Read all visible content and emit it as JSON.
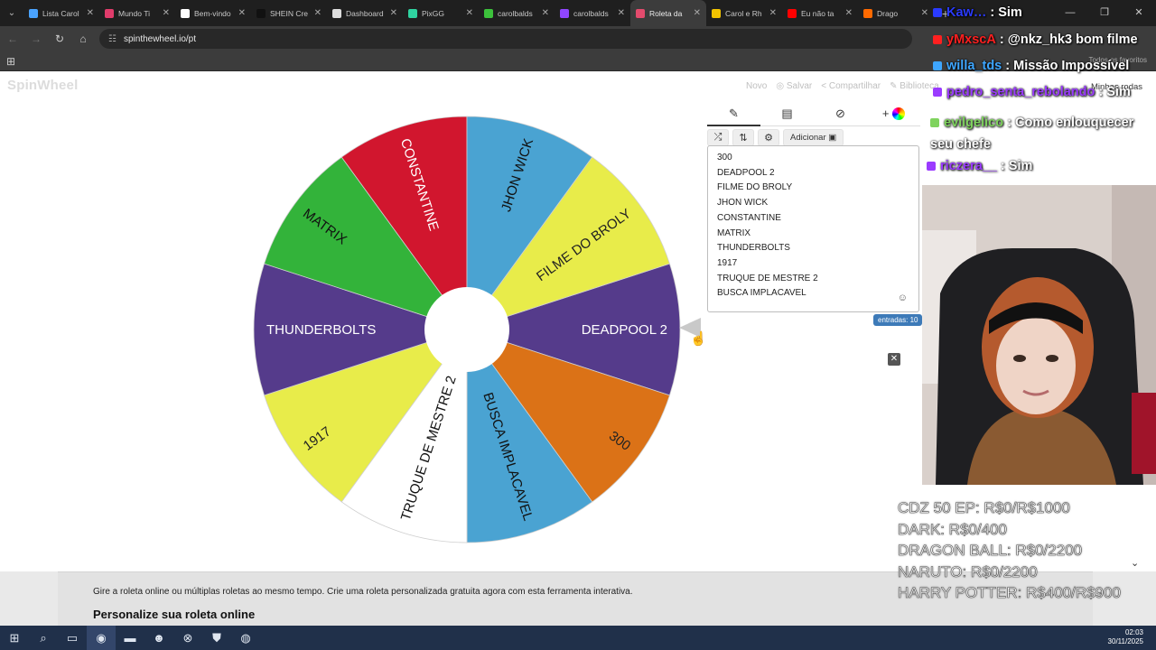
{
  "browser": {
    "tabs": [
      {
        "label": "Lista Carol",
        "color": "#4aa3ff",
        "active": false
      },
      {
        "label": "Mundo Ti",
        "color": "#e03c6b",
        "active": false
      },
      {
        "label": "Bem-vindo",
        "color": "#ffffff",
        "active": false
      },
      {
        "label": "SHEIN Cre",
        "color": "#111111",
        "active": false
      },
      {
        "label": "Dashboard",
        "color": "#dddddd",
        "active": false
      },
      {
        "label": "PixGG",
        "color": "#2fd3a0",
        "active": false
      },
      {
        "label": "carolbalds",
        "color": "#3cc13b",
        "active": false
      },
      {
        "label": "carolbalds",
        "color": "#9146ff",
        "active": false
      },
      {
        "label": "Roleta da",
        "color": "#e34b6d",
        "active": true
      },
      {
        "label": "Carol e Rh",
        "color": "#f2c300",
        "active": false
      },
      {
        "label": "Eu não ta",
        "color": "#ff0000",
        "active": false
      },
      {
        "label": "Drago",
        "color": "#ff6a00",
        "active": false
      }
    ],
    "url": "spinthewheel.io/pt",
    "favorites_label": "Todos os favoritos"
  },
  "site": {
    "logo": "SpinWheel",
    "toolbar": {
      "novo": "Novo",
      "salvar": "Salvar",
      "compartilhar": "Compartilhar",
      "biblioteca": "Biblioteca"
    },
    "my_wheels": "Minhas rodas"
  },
  "wheel": {
    "segments": [
      {
        "label": "DEADPOOL 2",
        "color": "#553b8b",
        "text_color": "#ffffff"
      },
      {
        "label": "300",
        "color": "#db7217",
        "text_color": "#222222"
      },
      {
        "label": "BUSCA IMPLACAVEL",
        "color": "#4aa3d2",
        "text_color": "#111111"
      },
      {
        "label": "TRUQUE DE MESTRE 2",
        "color": "#ffffff",
        "text_color": "#111111"
      },
      {
        "label": "1917",
        "color": "#e8ec4a",
        "text_color": "#222222"
      },
      {
        "label": "THUNDERBOLTS",
        "color": "#553b8b",
        "text_color": "#ffffff"
      },
      {
        "label": "MATRIX",
        "color": "#33b33a",
        "text_color": "#111111"
      },
      {
        "label": "CONSTANTINE",
        "color": "#d1162e",
        "text_color": "#ffffff"
      },
      {
        "label": "JHON WICK",
        "color": "#4aa3d2",
        "text_color": "#111111"
      },
      {
        "label": "FILME DO BROLY",
        "color": "#e8ec4a",
        "text_color": "#222222"
      }
    ]
  },
  "panel": {
    "add_label": "Adicionar",
    "entries": [
      "300",
      "DEADPOOL 2",
      "FILME DO BROLY",
      "JHON WICK",
      "CONSTANTINE",
      "MATRIX",
      "THUNDERBOLTS",
      "1917",
      "TRUQUE DE MESTRE 2",
      "BUSCA IMPLACAVEL"
    ],
    "count_label": "entradas: 10"
  },
  "description": {
    "text": "Gire a roleta online ou múltiplas roletas ao mesmo tempo. Crie uma roleta personalizada gratuita agora com esta ferramenta interativa.",
    "heading": "Personalize sua roleta online"
  },
  "chat": [
    {
      "user": "Kaw…",
      "msg": "Sim",
      "color": "#2a3bff"
    },
    {
      "user": "yMxscA",
      "msg": "@nkz_hk3 bom filme",
      "color": "#ff2020"
    },
    {
      "user": "willa_tds",
      "msg": "Missão Impossível",
      "color": "#3ea6ff"
    },
    {
      "user": "pedro_senta_rebolando",
      "msg": "Sim",
      "color": "#9b3bff"
    },
    {
      "user": "evilgelico",
      "msg": "Como enlouquecer seu chefe",
      "color": "#7fd35e"
    },
    {
      "user": "riczera__",
      "msg": "Sim",
      "color": "#9b3bff"
    }
  ],
  "goals": [
    "CDZ 50 EP: R$0/R$1000",
    "DARK: R$0/400",
    "DRAGON BALL: R$0/2200",
    "NARUTO: R$0/2200",
    "HARRY POTTER: R$400/R$900"
  ],
  "taskbar": {
    "time": "02:03",
    "date": "30/11/2025"
  }
}
